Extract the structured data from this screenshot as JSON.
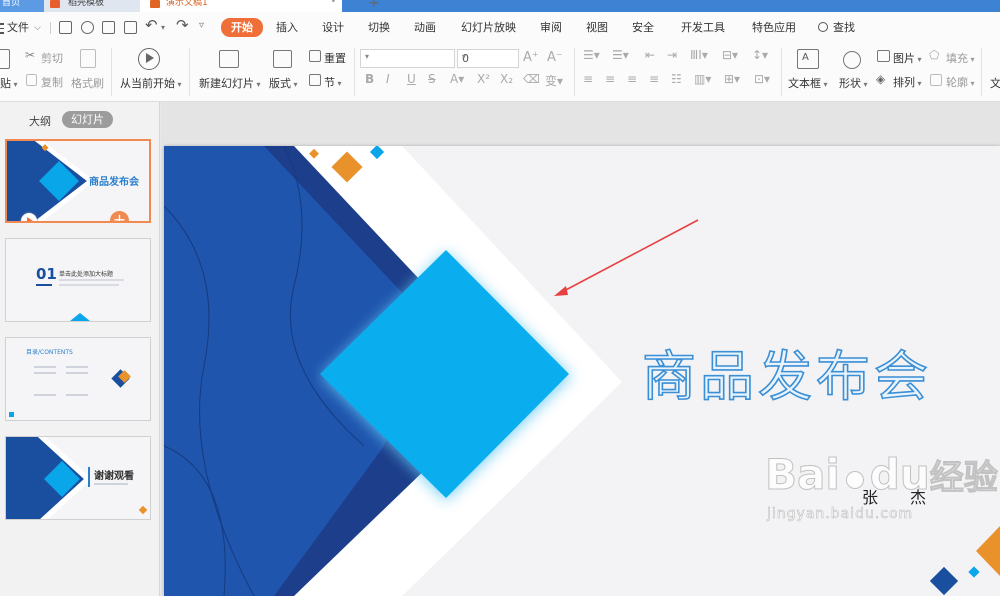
{
  "titlebar": {
    "tab1": "首页",
    "tab2": "稻壳模板",
    "tab3": "演示文稿1"
  },
  "menubar": {
    "file": "文件",
    "items": [
      "开始",
      "插入",
      "设计",
      "切换",
      "动画",
      "幻灯片放映",
      "审阅",
      "视图",
      "安全",
      "开发工具",
      "特色应用"
    ],
    "search": "查找"
  },
  "toolbar": {
    "paste": "贴",
    "cut": "剪切",
    "copy": "复制",
    "format_painter": "格式刷",
    "play_from_current": "从当前开始",
    "new_slide": "新建幻灯片",
    "layout": "版式",
    "reset": "重置",
    "section": "节",
    "font_size": "0",
    "textbox": "文本框",
    "shape": "形状",
    "picture": "图片",
    "arrange": "排列",
    "fill": "填充",
    "outline": "轮廓",
    "text_cut": "文"
  },
  "panel": {
    "outline_tab": "大纲",
    "slides_tab": "幻灯片",
    "thumb1_title": "商品发布会",
    "thumb2_number": "01",
    "thumb2_title": "单击此处添加大标题",
    "thumb3_title": "目录/CONTENTS",
    "thumb4_title": "谢谢观看"
  },
  "slide": {
    "title": "商品发布会",
    "author": "张　　杰"
  },
  "watermark": {
    "brand": "Bai",
    "brand2": "du",
    "brand3": "经验",
    "url": "jingyan.baidu.com"
  },
  "colors": {
    "accent": "#f06e37",
    "navy": "#1a4fa0",
    "cyan": "#0aa6ea",
    "orange": "#e9922b",
    "title_stroke": "#3a8fd6",
    "arrow": "#e84040"
  }
}
